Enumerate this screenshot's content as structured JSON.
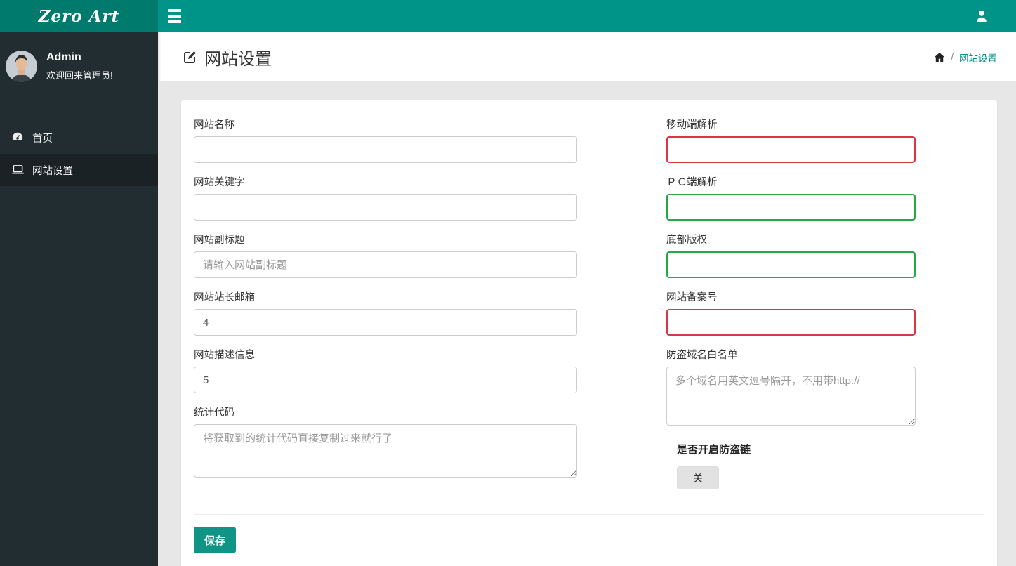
{
  "topbar": {
    "logo": "Zero Art",
    "hamburger_icon": "hamburger-icon",
    "user_icon": "user-icon"
  },
  "sidebar": {
    "user": {
      "name": "Admin",
      "welcome": "欢迎回来管理员!"
    },
    "items": [
      {
        "label": "首页",
        "icon": "dashboard-icon",
        "active": false
      },
      {
        "label": "网站设置",
        "icon": "laptop-icon",
        "active": true
      }
    ]
  },
  "header": {
    "title": "网站设置",
    "title_icon": "edit-icon",
    "breadcrumb": {
      "home_icon": "home-icon",
      "separator": "/",
      "current": "网站设置"
    }
  },
  "form": {
    "left_fields": [
      {
        "name": "site-name-field",
        "label": "网站名称",
        "type": "input",
        "value": "",
        "placeholder": "",
        "border": "normal"
      },
      {
        "name": "site-keywords-field",
        "label": "网站关键字",
        "type": "input",
        "value": "",
        "placeholder": "",
        "border": "normal"
      },
      {
        "name": "site-subtitle-field",
        "label": "网站副标题",
        "type": "input",
        "value": "",
        "placeholder": "请输入网站副标题",
        "border": "normal"
      },
      {
        "name": "webmaster-email-field",
        "label": "网站站长邮箱",
        "type": "input",
        "value": "4",
        "placeholder": "",
        "border": "normal"
      },
      {
        "name": "site-description-field",
        "label": "网站描述信息",
        "type": "input",
        "value": "5",
        "placeholder": "",
        "border": "normal"
      },
      {
        "name": "statistics-code-field",
        "label": "统计代码",
        "type": "textarea",
        "value": "",
        "placeholder": "将获取到的统计代码直接复制过来就行了",
        "border": "normal"
      }
    ],
    "right_fields": [
      {
        "name": "mobile-parse-field",
        "label": "移动端解析",
        "type": "input",
        "value": "",
        "placeholder": "",
        "border": "red"
      },
      {
        "name": "pc-parse-field",
        "label": "ＰＣ端解析",
        "type": "input",
        "value": "",
        "placeholder": "",
        "border": "green"
      },
      {
        "name": "footer-copyright-field",
        "label": "底部版权",
        "type": "input",
        "value": "",
        "placeholder": "",
        "border": "green"
      },
      {
        "name": "icp-number-field",
        "label": "网站备案号",
        "type": "input",
        "value": "",
        "placeholder": "",
        "border": "red"
      },
      {
        "name": "hotlink-whitelist-field",
        "label": "防盗域名白名单",
        "type": "textarea-tall",
        "value": "",
        "placeholder": "多个域名用英文逗号隔开，不用带http://",
        "border": "normal"
      }
    ],
    "hotlink_toggle": {
      "label": "是否开启防盗链",
      "state_label": "关"
    },
    "save_label": "保存"
  },
  "colors": {
    "navbar_teal": "#009489",
    "logo_teal_dark": "#007a6c",
    "sidebar_dark": "#222d32",
    "sidebar_active": "#1a2226",
    "page_bg": "#e7e7e7",
    "error_border": "#dc3545",
    "success_border": "#28a745",
    "save_button": "#0f9485",
    "breadcrumb_link": "#009489"
  }
}
